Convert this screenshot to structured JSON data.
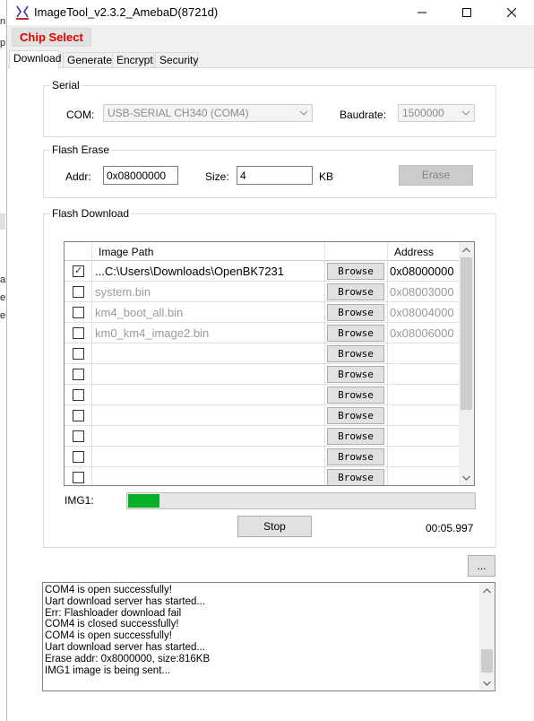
{
  "window": {
    "title": "ImageTool_v2.3.2_AmebaD(8721d)"
  },
  "chip_select_label": "Chip Select",
  "tabs": [
    {
      "label": "Download"
    },
    {
      "label": "Generate"
    },
    {
      "label": "Encrypt"
    },
    {
      "label": "Security"
    }
  ],
  "serial": {
    "group_label": "Serial",
    "com_label": "COM:",
    "com_value": "USB-SERIAL CH340 (COM4)",
    "baud_label": "Baudrate:",
    "baud_value": "1500000"
  },
  "flash_erase": {
    "group_label": "Flash Erase",
    "addr_label": "Addr:",
    "addr_value": "0x08000000",
    "size_label": "Size:",
    "size_value": "4",
    "size_unit": "KB",
    "erase_label": "Erase"
  },
  "flash_download": {
    "group_label": "Flash Download",
    "columns": {
      "path": "Image Path",
      "address": "Address"
    },
    "browse_label": "Browse",
    "rows": [
      {
        "checked": true,
        "path": "C:\\Users\\Downloads\\OpenBK7231...",
        "address": "0x08000000",
        "enabled": true
      },
      {
        "checked": false,
        "path": "system.bin",
        "address": "0x08003000",
        "enabled": false
      },
      {
        "checked": false,
        "path": "km4_boot_all.bin",
        "address": "0x08004000",
        "enabled": false
      },
      {
        "checked": false,
        "path": "km0_km4_image2.bin",
        "address": "0x08006000",
        "enabled": false
      },
      {
        "checked": false,
        "path": "",
        "address": "",
        "enabled": true
      },
      {
        "checked": false,
        "path": "",
        "address": "",
        "enabled": true
      },
      {
        "checked": false,
        "path": "",
        "address": "",
        "enabled": true
      },
      {
        "checked": false,
        "path": "",
        "address": "",
        "enabled": true
      },
      {
        "checked": false,
        "path": "",
        "address": "",
        "enabled": true
      },
      {
        "checked": false,
        "path": "",
        "address": "",
        "enabled": true
      },
      {
        "checked": false,
        "path": "",
        "address": "",
        "enabled": true
      }
    ],
    "progress_label": "IMG1:",
    "progress_value": 0.09,
    "stop_label": "Stop",
    "elapsed": "00:05.997"
  },
  "more_button_label": "...",
  "log_lines": [
    "COM4 is open successfully!",
    "Uart download server has started...",
    "Err: Flashloader download fail",
    "COM4 is closed successfully!",
    "COM4 is open successfully!",
    "Uart download server has started...",
    "Erase addr: 0x8000000, size:816KB",
    "IMG1 image is being sent..."
  ],
  "background_fragments": [
    "n",
    "p",
    "al",
    "el",
    "el"
  ],
  "colors": {
    "chip_select_text": "#e00000",
    "progress_fill": "#06b025"
  },
  "icons": {
    "app": "app-logo-icon",
    "minimize": "minimize-icon",
    "maximize": "maximize-icon",
    "close": "close-icon",
    "dropdown": "chevron-down-icon",
    "checkbox_mark": "check-icon"
  }
}
